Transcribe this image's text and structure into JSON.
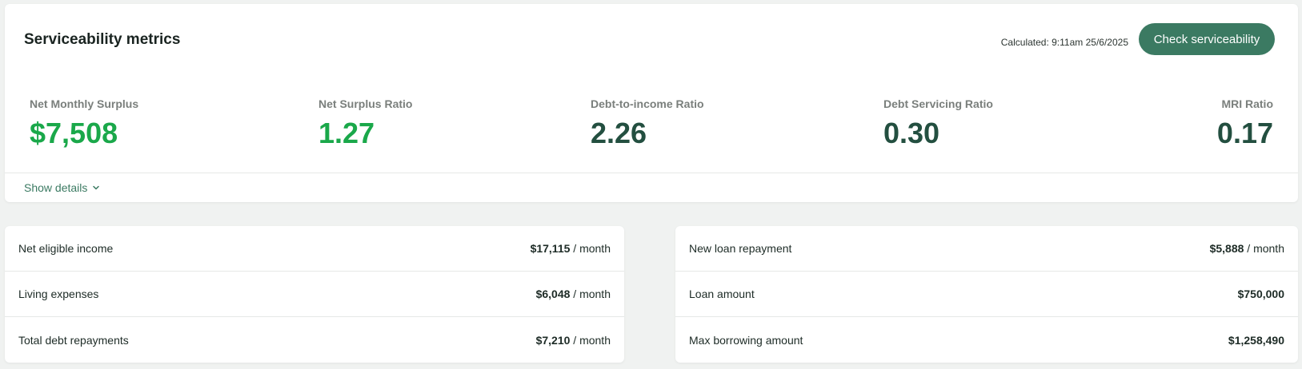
{
  "header": {
    "title": "Serviceability metrics",
    "calculated": "Calculated: 9:11am 25/6/2025",
    "check_button": "Check serviceability"
  },
  "metrics": [
    {
      "label": "Net Monthly Surplus",
      "value": "$7,508",
      "color": "#1aa84a"
    },
    {
      "label": "Net Surplus Ratio",
      "value": "1.27",
      "color": "#1aa84a"
    },
    {
      "label": "Debt-to-income Ratio",
      "value": "2.26",
      "color": "#234f40"
    },
    {
      "label": "Debt Servicing Ratio",
      "value": "0.30",
      "color": "#234f40"
    },
    {
      "label": "MRI Ratio",
      "value": "0.17",
      "color": "#234f40"
    }
  ],
  "show_details": "Show details",
  "left_rows": [
    {
      "label": "Net eligible income",
      "value": "$17,115",
      "unit": " / month"
    },
    {
      "label": "Living expenses",
      "value": "$6,048",
      "unit": " / month"
    },
    {
      "label": "Total debt repayments",
      "value": "$7,210",
      "unit": " / month"
    }
  ],
  "right_rows": [
    {
      "label": "New loan repayment",
      "value": "$5,888",
      "unit": " / month"
    },
    {
      "label": "Loan amount",
      "value": "$750,000",
      "unit": ""
    },
    {
      "label": "Max borrowing amount",
      "value": "$1,258,490",
      "unit": ""
    }
  ]
}
